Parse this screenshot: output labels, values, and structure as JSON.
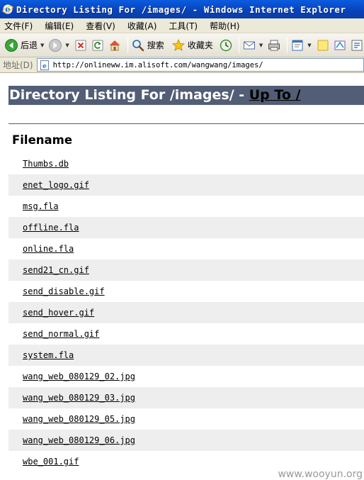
{
  "window": {
    "title": "Directory Listing For /images/ - Windows Internet Explorer"
  },
  "menu": {
    "items": [
      "文件(F)",
      "编辑(E)",
      "查看(V)",
      "收藏(A)",
      "工具(T)",
      "帮助(H)"
    ]
  },
  "toolbar": {
    "back_label": "后退",
    "search_label": "搜索",
    "favorites_label": "收藏夹"
  },
  "address": {
    "label": "地址(D)",
    "url": "http://onlineww.im.alisoft.com/wangwang/images/"
  },
  "page": {
    "heading_prefix": "Directory Listing For /images/ - ",
    "up_link": "Up To /",
    "column_header": "Filename",
    "files": [
      "Thumbs.db",
      "enet_logo.gif",
      "msg.fla",
      "offline.fla",
      "online.fla",
      "send21_cn.gif",
      "send_disable.gif",
      "send_hover.gif",
      "send_normal.gif",
      "system.fla",
      "wang_web_080129_02.jpg",
      "wang_web_080129_03.jpg",
      "wang_web_080129_05.jpg",
      "wang_web_080129_06.jpg",
      "wbe_001.gif"
    ]
  },
  "watermark": "www.wooyun.org",
  "colors": {
    "heading_bg": "#525d76",
    "row_stripe": "#eeeeee",
    "titlebar": "#0a5ce0"
  },
  "icons": {
    "title": "ie-logo-icon",
    "back": "back-arrow-icon",
    "forward": "forward-arrow-icon",
    "stop": "stop-icon",
    "refresh": "refresh-icon",
    "home": "home-icon",
    "search": "search-icon",
    "favorites": "star-icon",
    "history": "history-icon",
    "mail": "mail-icon",
    "print": "print-icon",
    "edit": "edit-icon",
    "notes": "note-icon",
    "messenger": "messenger-icon",
    "research": "research-icon",
    "page": "page-icon"
  }
}
